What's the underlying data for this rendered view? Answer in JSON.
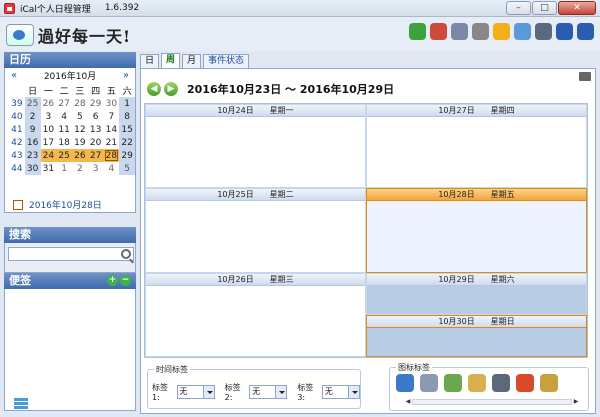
{
  "window": {
    "title": "iCal个人日程管理",
    "version": "1.6.392",
    "minimize": "–",
    "maximize": "□",
    "close": "✕"
  },
  "logo": {
    "text": "過好每一天!"
  },
  "toolbar": {
    "icons": [
      "exit-icon",
      "weather-icon",
      "settings-icon",
      "clock-icon",
      "favorite-icon",
      "chat-icon",
      "home-icon",
      "help-icon",
      "info-icon"
    ],
    "colors": [
      "#3ca33c",
      "#d04a3a",
      "#7a8aa6",
      "#888888",
      "#f2b016",
      "#5a9ad8",
      "#5a6a7a",
      "#2a5db0",
      "#2a5db0"
    ]
  },
  "calendar": {
    "header": "日历",
    "prev": "«",
    "next": "»",
    "month": "2016年10月",
    "weekdays": [
      "日",
      "一",
      "二",
      "三",
      "四",
      "五",
      "六"
    ],
    "weeks": [
      {
        "wk": "39",
        "days": [
          "25",
          "26",
          "27",
          "28",
          "29",
          "30",
          "1"
        ]
      },
      {
        "wk": "40",
        "days": [
          "2",
          "3",
          "4",
          "5",
          "6",
          "7",
          "8"
        ]
      },
      {
        "wk": "41",
        "days": [
          "9",
          "10",
          "11",
          "12",
          "13",
          "14",
          "15"
        ]
      },
      {
        "wk": "42",
        "days": [
          "16",
          "17",
          "18",
          "19",
          "20",
          "21",
          "22"
        ]
      },
      {
        "wk": "43",
        "days": [
          "23",
          "24",
          "25",
          "26",
          "27",
          "28",
          "29"
        ]
      },
      {
        "wk": "44",
        "days": [
          "30",
          "31",
          "1",
          "2",
          "3",
          "4",
          "5"
        ]
      }
    ],
    "today": "2016年10月28日"
  },
  "search": {
    "header": "搜索",
    "placeholder": ""
  },
  "notes": {
    "header": "便签",
    "add": "+",
    "remove": "−"
  },
  "tabs": [
    {
      "label": "日"
    },
    {
      "label": "周"
    },
    {
      "label": "月"
    },
    {
      "label": "事件状态"
    }
  ],
  "week": {
    "prev": "◀",
    "next": "▶",
    "range": "2016年10月23日 ～ 2016年10月29日",
    "days": [
      {
        "date": "10月24日",
        "weekday": "星期一"
      },
      {
        "date": "10月25日",
        "weekday": "星期二"
      },
      {
        "date": "10月26日",
        "weekday": "星期三"
      },
      {
        "date": "10月27日",
        "weekday": "星期四"
      },
      {
        "date": "10月28日",
        "weekday": "星期五"
      },
      {
        "date": "10月29日",
        "weekday": "星期六"
      },
      {
        "date": "10月30日",
        "weekday": "星期日"
      }
    ]
  },
  "timeTags": {
    "legend": "时间标签",
    "tag1": "标签1:",
    "tag2": "标签2:",
    "tag3": "标签3:",
    "value": "无"
  },
  "iconTags": {
    "legend": "图标标签",
    "icons": [
      "people-icon",
      "airplane-icon",
      "money-icon",
      "tools-icon",
      "treadmill-icon",
      "gift-icon",
      "pencil-icon"
    ],
    "colors": [
      "#3a7ac8",
      "#8a9ab0",
      "#6aa84f",
      "#d8b050",
      "#5a6a7a",
      "#d84a2a",
      "#c8a040"
    ]
  }
}
